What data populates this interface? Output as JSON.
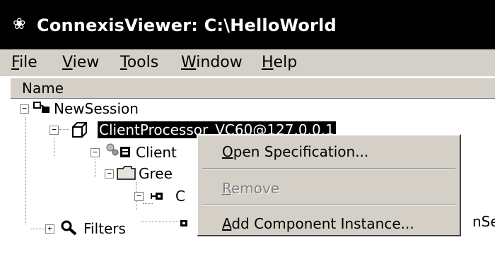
{
  "window": {
    "title": "ConnexisViewer: C:\\HelloWorld",
    "icon": "app-icon"
  },
  "menu": [
    {
      "mnemonic": "F",
      "rest": "ile"
    },
    {
      "mnemonic": "V",
      "rest": "iew"
    },
    {
      "mnemonic": "T",
      "rest": "ools"
    },
    {
      "mnemonic": "W",
      "rest": "indow"
    },
    {
      "mnemonic": "H",
      "rest": "elp"
    }
  ],
  "column_header": "Name",
  "tree": {
    "session": "NewSession",
    "processor": "ClientProcessor_VC60@127.0.0.1",
    "client": "Client",
    "greeting": "Gree",
    "component": "C",
    "instance_suffix": "nSer.",
    "filters": "Filters"
  },
  "context_menu": {
    "open_mnemonic": "O",
    "open_rest": "pen Specification...",
    "remove_mnemonic": "R",
    "remove_rest": "emove",
    "add_mnemonic": "A",
    "add_rest": "dd Component Instance..."
  }
}
